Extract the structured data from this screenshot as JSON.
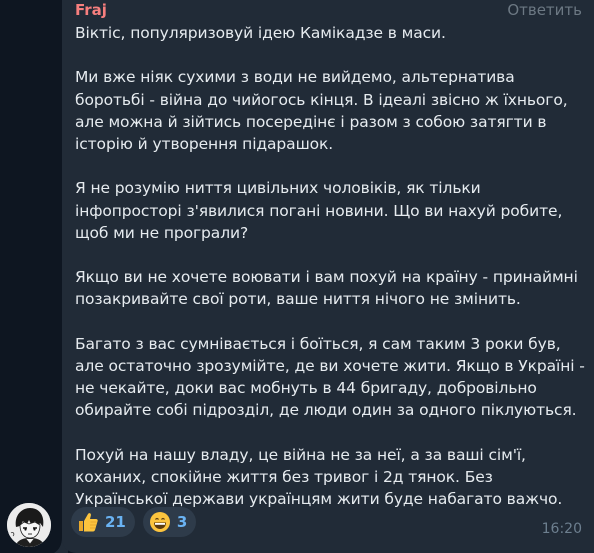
{
  "message": {
    "sender": "Fraj",
    "reply_label": "Ответить",
    "text": "Віктіс, популяризовуй ідею Камікадзе в маси.\n\nМи вже ніяк сухими з води не вийдемо, альтернатива боротьбі - війна до чийогось кінця. В ідеалі звісно ж їхнього, але можна й зійтись посередінє і разом з собою затягти в історію й утворення підарашок.\n\nЯ не розумію ниття цивільних чоловіків, як тільки інфопросторі з'явилися погані новини. Що ви нахуй робите, щоб ми не програли?\n\nЯкщо ви не хочете воювати і вам похуй на країну - принаймні позакривайте свої роти, ваше ниття нічого не змінить.\n\nБагато з вас сумнівається і боїться, я сам таким 3 роки був, але остаточно зрозумійте, де ви хочете жити. Якщо в Україні - не чекайте, доки вас мобнуть в 44 бригаду, добровільно обирайте собі підрозділ, де люди один за одного піклуються.\n\nПохуй на нашу владу, це війна не за неї, а за ваші сім'ї, коханих, спокійне життя без тривог і 2д тянок. Без Української держави українцям жити буде набагато важчо.",
    "time": "16:20",
    "reactions": [
      {
        "icon": "thumbs-up-icon",
        "count": "21"
      },
      {
        "icon": "grinning-face-icon",
        "count": "3"
      }
    ]
  },
  "colors": {
    "background": "#0e1621",
    "bubble": "#212b37",
    "sender": "#f77f7e",
    "reaction_count": "#6ab3f3",
    "reaction_bg": "#2e3b4a",
    "meta_text": "#6d7f8f"
  }
}
